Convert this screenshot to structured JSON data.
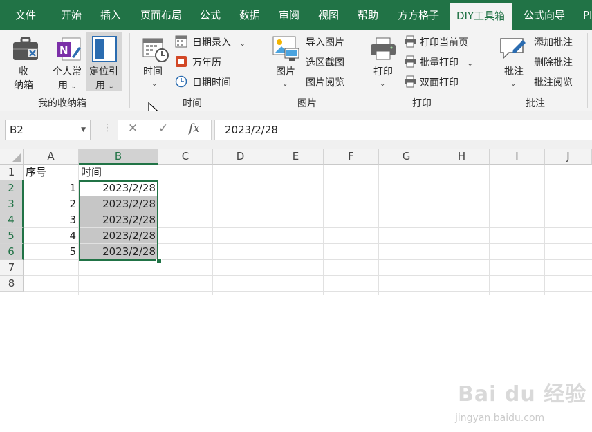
{
  "tabs": [
    {
      "label": "文件"
    },
    {
      "label": "开始"
    },
    {
      "label": "插入"
    },
    {
      "label": "页面布局"
    },
    {
      "label": "公式"
    },
    {
      "label": "数据"
    },
    {
      "label": "审阅"
    },
    {
      "label": "视图"
    },
    {
      "label": "帮助"
    },
    {
      "label": "方方格子"
    },
    {
      "label": "DIY工具箱"
    },
    {
      "label": "公式向导"
    },
    {
      "label": "PI"
    }
  ],
  "ribbon": {
    "group1": {
      "label": "我的收纳箱",
      "buttons": [
        {
          "line1": "收",
          "line2": "纳箱"
        },
        {
          "line1": "个人常",
          "line2": "用"
        },
        {
          "line1": "定位引",
          "line2": "用"
        }
      ]
    },
    "group2": {
      "label": "时间",
      "big": "时间",
      "items": [
        "日期录入",
        "万年历",
        "日期时间"
      ]
    },
    "group3": {
      "label": "图片",
      "big": "图片",
      "items": [
        "导入图片",
        "选区截图",
        "图片阅览"
      ]
    },
    "group4": {
      "label": "打印",
      "big": "打印",
      "items": [
        "打印当前页",
        "批量打印",
        "双面打印"
      ]
    },
    "group5": {
      "label": "批注",
      "big": "批注",
      "items": [
        "添加批注",
        "删除批注",
        "批注阅览"
      ]
    }
  },
  "formula_bar": {
    "name_box": "B2",
    "cancel": "✕",
    "enter": "✓",
    "fx": "fx",
    "value": "2023/2/28"
  },
  "sheet": {
    "columns": [
      "A",
      "B",
      "C",
      "D",
      "E",
      "F",
      "G",
      "H",
      "I",
      "J"
    ],
    "rows": [
      "1",
      "2",
      "3",
      "4",
      "5",
      "6",
      "7",
      "8"
    ],
    "header_row": {
      "a": "序号",
      "b": "时间"
    },
    "data": [
      {
        "a": "1",
        "b": "2023/2/28"
      },
      {
        "a": "2",
        "b": "2023/2/28"
      },
      {
        "a": "3",
        "b": "2023/2/28"
      },
      {
        "a": "4",
        "b": "2023/2/28"
      },
      {
        "a": "5",
        "b": "2023/2/28"
      }
    ]
  },
  "watermark": {
    "main": "Bai du 经验",
    "sub": "jingyan.baidu.com"
  }
}
